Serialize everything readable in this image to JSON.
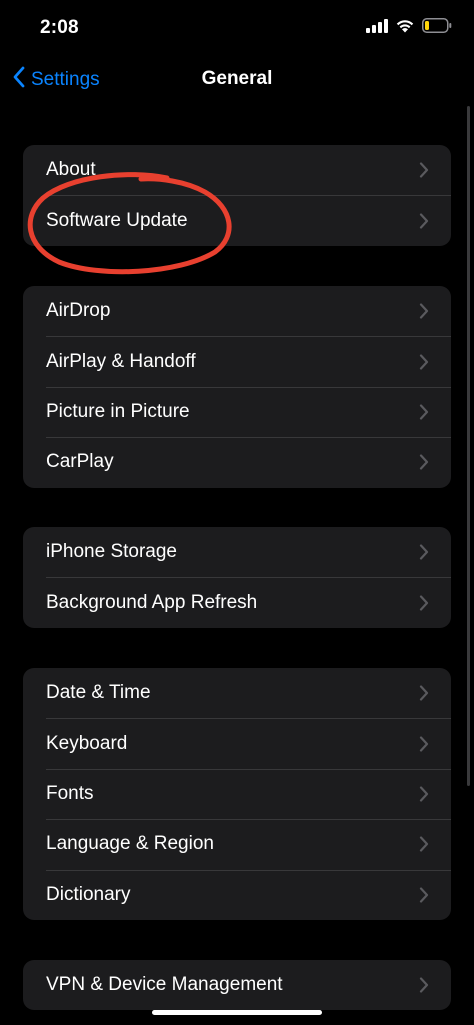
{
  "status_bar": {
    "time": "2:08",
    "icons": [
      "cellular-signal-icon",
      "wifi-icon",
      "battery-icon"
    ],
    "battery_color": "#ffd60a"
  },
  "nav": {
    "back_label": "Settings",
    "title": "General"
  },
  "groups": [
    {
      "rows": [
        {
          "label": "About"
        },
        {
          "label": "Software Update"
        }
      ]
    },
    {
      "rows": [
        {
          "label": "AirDrop"
        },
        {
          "label": "AirPlay & Handoff"
        },
        {
          "label": "Picture in Picture"
        },
        {
          "label": "CarPlay"
        }
      ]
    },
    {
      "rows": [
        {
          "label": "iPhone Storage"
        },
        {
          "label": "Background App Refresh"
        }
      ]
    },
    {
      "rows": [
        {
          "label": "Date & Time"
        },
        {
          "label": "Keyboard"
        },
        {
          "label": "Fonts"
        },
        {
          "label": "Language & Region"
        },
        {
          "label": "Dictionary"
        }
      ]
    },
    {
      "rows": [
        {
          "label": "VPN & Device Management"
        }
      ]
    }
  ],
  "colors": {
    "background": "#000000",
    "cell": "#1c1c1e",
    "separator": "#38383a",
    "accent": "#0a84ff",
    "chevron": "#5a5a5e",
    "annotation": "#e8402f"
  }
}
